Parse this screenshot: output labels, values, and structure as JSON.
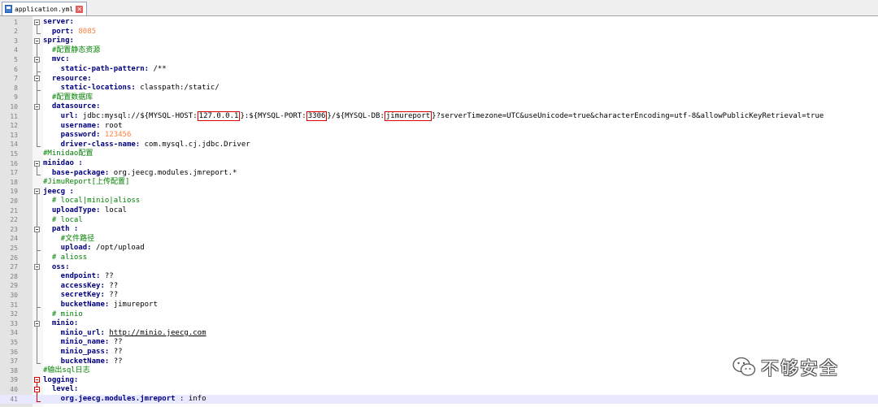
{
  "tab": {
    "filename": "application.yml",
    "close_glyph": "✕"
  },
  "watermark": {
    "text": "不够安全"
  },
  "lines": [
    {
      "n": "1",
      "parts": [
        {
          "t": "server:",
          "c": "k"
        }
      ]
    },
    {
      "n": "2",
      "parts": [
        {
          "t": "  port: ",
          "c": "k"
        },
        {
          "t": "8085",
          "c": "num"
        }
      ]
    },
    {
      "n": "3",
      "parts": [
        {
          "t": "spring:",
          "c": "k"
        }
      ]
    },
    {
      "n": "4",
      "parts": [
        {
          "t": "  #配置静态资源",
          "c": "cm"
        }
      ]
    },
    {
      "n": "5",
      "parts": [
        {
          "t": "  mvc:",
          "c": "k"
        }
      ]
    },
    {
      "n": "6",
      "parts": [
        {
          "t": "    static-path-pattern: ",
          "c": "k"
        },
        {
          "t": "/**",
          "c": ""
        }
      ]
    },
    {
      "n": "7",
      "parts": [
        {
          "t": "  resource:",
          "c": "k"
        }
      ]
    },
    {
      "n": "8",
      "parts": [
        {
          "t": "    static-locations: ",
          "c": "k"
        },
        {
          "t": "classpath:/static/",
          "c": ""
        }
      ]
    },
    {
      "n": "9",
      "parts": [
        {
          "t": "  #配置数据库",
          "c": "cm"
        }
      ]
    },
    {
      "n": "10",
      "parts": [
        {
          "t": "  datasource:",
          "c": "k"
        }
      ]
    },
    {
      "n": "11",
      "parts": [
        {
          "t": "    url: ",
          "c": "k"
        },
        {
          "t": "jdbc:mysql://${MYSQL-HOST:",
          "c": ""
        },
        {
          "t": "127.0.0.1",
          "c": "box"
        },
        {
          "t": "}:${MYSQL-PORT:",
          "c": ""
        },
        {
          "t": "3306",
          "c": "box"
        },
        {
          "t": "}/${MYSQL-DB:",
          "c": ""
        },
        {
          "t": "jimureport",
          "c": "box"
        },
        {
          "t": "}?serverTimezone=UTC&useUnicode=true&characterEncoding=utf-8&allowPublicKeyRetrieval=true",
          "c": ""
        }
      ]
    },
    {
      "n": "12",
      "parts": [
        {
          "t": "    username: ",
          "c": "k"
        },
        {
          "t": "root",
          "c": ""
        }
      ]
    },
    {
      "n": "13",
      "parts": [
        {
          "t": "    password: ",
          "c": "k"
        },
        {
          "t": "123456",
          "c": "num"
        }
      ]
    },
    {
      "n": "14",
      "parts": [
        {
          "t": "    driver-class-name: ",
          "c": "k"
        },
        {
          "t": "com.mysql.cj.jdbc.Driver",
          "c": ""
        }
      ]
    },
    {
      "n": "15",
      "parts": [
        {
          "t": "#Minidao配置",
          "c": "cm"
        }
      ]
    },
    {
      "n": "16",
      "parts": [
        {
          "t": "minidao :",
          "c": "k"
        }
      ]
    },
    {
      "n": "17",
      "parts": [
        {
          "t": "  base-package: ",
          "c": "k"
        },
        {
          "t": "org.jeecg.modules.jmreport.*",
          "c": ""
        }
      ]
    },
    {
      "n": "18",
      "parts": [
        {
          "t": "#JimuReport[上传配置]",
          "c": "cm"
        }
      ]
    },
    {
      "n": "19",
      "parts": [
        {
          "t": "jeecg :",
          "c": "k"
        }
      ]
    },
    {
      "n": "20",
      "parts": [
        {
          "t": "  # local|minio|alioss",
          "c": "cm"
        }
      ]
    },
    {
      "n": "21",
      "parts": [
        {
          "t": "  uploadType: ",
          "c": "k"
        },
        {
          "t": "local",
          "c": ""
        }
      ]
    },
    {
      "n": "22",
      "parts": [
        {
          "t": "  # local",
          "c": "cm"
        }
      ]
    },
    {
      "n": "23",
      "parts": [
        {
          "t": "  path :",
          "c": "k"
        }
      ]
    },
    {
      "n": "24",
      "parts": [
        {
          "t": "    #文件路径",
          "c": "cm"
        }
      ]
    },
    {
      "n": "25",
      "parts": [
        {
          "t": "    upload: ",
          "c": "k"
        },
        {
          "t": "/opt/upload",
          "c": ""
        }
      ]
    },
    {
      "n": "26",
      "parts": [
        {
          "t": "  # alioss",
          "c": "cm"
        }
      ]
    },
    {
      "n": "27",
      "parts": [
        {
          "t": "  oss:",
          "c": "k"
        }
      ]
    },
    {
      "n": "28",
      "parts": [
        {
          "t": "    endpoint: ",
          "c": "k"
        },
        {
          "t": "??",
          "c": ""
        }
      ]
    },
    {
      "n": "29",
      "parts": [
        {
          "t": "    accessKey: ",
          "c": "k"
        },
        {
          "t": "??",
          "c": ""
        }
      ]
    },
    {
      "n": "30",
      "parts": [
        {
          "t": "    secretKey: ",
          "c": "k"
        },
        {
          "t": "??",
          "c": ""
        }
      ]
    },
    {
      "n": "31",
      "parts": [
        {
          "t": "    bucketName: ",
          "c": "k"
        },
        {
          "t": "jimureport",
          "c": ""
        }
      ]
    },
    {
      "n": "32",
      "parts": [
        {
          "t": "  # minio",
          "c": "cm"
        }
      ]
    },
    {
      "n": "33",
      "parts": [
        {
          "t": "  minio:",
          "c": "k"
        }
      ]
    },
    {
      "n": "34",
      "parts": [
        {
          "t": "    minio_url: ",
          "c": "k"
        },
        {
          "t": "http://minio.jeecg.com",
          "c": "ul"
        }
      ]
    },
    {
      "n": "35",
      "parts": [
        {
          "t": "    minio_name: ",
          "c": "k"
        },
        {
          "t": "??",
          "c": ""
        }
      ]
    },
    {
      "n": "36",
      "parts": [
        {
          "t": "    minio_pass: ",
          "c": "k"
        },
        {
          "t": "??",
          "c": ""
        }
      ]
    },
    {
      "n": "37",
      "parts": [
        {
          "t": "    bucketName: ",
          "c": "k"
        },
        {
          "t": "??",
          "c": ""
        }
      ]
    },
    {
      "n": "38",
      "parts": [
        {
          "t": "#输出sql日志",
          "c": "cm"
        }
      ]
    },
    {
      "n": "39",
      "parts": [
        {
          "t": "logging:",
          "c": "k"
        }
      ]
    },
    {
      "n": "40",
      "parts": [
        {
          "t": "  level:",
          "c": "k"
        }
      ]
    },
    {
      "n": "41",
      "parts": [
        {
          "t": "    org.jeecg.modules.jmreport",
          "c": "k"
        },
        {
          "t": " : ",
          "c": ""
        },
        {
          "t": "info",
          "c": ""
        }
      ]
    }
  ],
  "current_line": "41"
}
